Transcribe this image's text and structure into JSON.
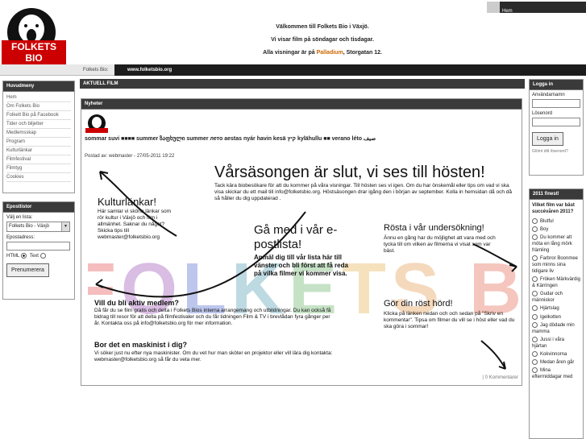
{
  "header": {
    "logo_text": "FOLKETS BIO",
    "line1": "Välkommen till Folkets Bio i Växjö.",
    "line2": "Vi visar film på söndagar och tisdagar.",
    "line3_pre": "Alla visningar är på",
    "line3_venue": "Palladium",
    "line3_post": ", Storgatan  12."
  },
  "topnav": {
    "home": "Hem"
  },
  "breadcrumb": {
    "label": "Folkets Bio:",
    "url": "www.folketsbio.org"
  },
  "menu": {
    "title": "Huvudmeny",
    "items": [
      "Hem",
      "Om Folkets Bio",
      "Folkett Bio på Facebook",
      "Tider och biljetter",
      "Medlemsskap",
      "Program",
      "Kulturlänkar",
      "Filmfestival",
      "Filmtyg",
      "Cookies"
    ]
  },
  "epost": {
    "title": "Epostlistor",
    "list_label": "Välj en lista:",
    "list_value": "Folkets Bio - Växjö",
    "address_label": "Epostadress:",
    "fmt_html": "HTML",
    "fmt_text": "Text",
    "submit": "Prenumerera"
  },
  "main": {
    "section_title": "AKTUELL FILM",
    "news_title": "Nyheter",
    "flags_line": "sommar suvi ■■■■ summer ზაფხული summer   лето aestas nyár havin kesä קיץ kylähullu ■■ verano léto صيف",
    "posted": "Postad av: webmaster - 27/05-2011 19:22",
    "comments": "| 0 Kommentarer"
  },
  "poster": {
    "bg_word": "FOLKETS BIO",
    "h1": "Vårsäsongen är slut, vi ses till hösten!",
    "p1": "Tack kära biobesökare för att du kommer på våra visningar. Till hösten ses vi igen. Om du har önskemål eller tips om vad vi ska visa skickar du ett mail till info@folketsbio.org. Höstsäsongen drar igång den i början av september. Kolla in hemsidan då och då så håller du dig uppdaterad .",
    "kultur_h": "Kulturlänkar!",
    "kultur_p": "Här samlar vi sköna länkar som rör kultur i Växjö och film i allmänhet. Saknar du något? Skicka tips till webmaster@folketsbio.org",
    "epost_h": "Gå med i vår e-postlista!",
    "epost_p": "Anmäl dig till vår lista här till vänster och bli först att få reda på vilka filmer vi kommer visa.",
    "rosta_h": "Rösta i vår undersökning!",
    "rosta_p": "Ännu en gång har du möjlighet att vara med och tycka till om vilken av filmerna vi visat som var bäst.",
    "medlem_h": "Vill du bli aktiv medlem?",
    "medlem_p": "Då får du se film gratis och delta i Folkets Bios interna arrangemang och utbildningar. Du kan också få bidrag till resor för att delta på filmfestivaler och du får tidningen Film & TV i brevlådan fyra gånger per år. Kontakta oss på info@folketsbio.org för mer information.",
    "rost_h": "Gör din röst hörd!",
    "rost_p": "Klicka på länken nedan och och sedan på \"Skriv en kommentar\". Tipsa om filmer du vill se i höst eller vad du ska göra i sommar!",
    "mask_h": "Bor det en maskinist i dig?",
    "mask_p": "Vi söker just nu efter nya maskinister. Om du vet hur man sköter en projektor eller vill lära dig kontakta: webmaster@folketsbio.org så får du veta mer."
  },
  "login": {
    "title": "Logga in",
    "user_label": "Användarnamn",
    "pass_label": "Lösenord",
    "submit": "Logga in",
    "forgot": "Glömt ditt lösenord?"
  },
  "poll": {
    "title": "2011 finest!",
    "question": "Vilket film var bäst succévåren 2011?",
    "options": [
      "Blutful",
      "Boy",
      "Du kommer att möta en lång mörk främling",
      "Farbror Boonmee som minns sina tidigare liv",
      "Fröken Märkvärdig & Kärringen",
      "Gudar och människor",
      "Hjärtslag",
      "Igelkotten",
      "Jag dödade min mamma",
      "Jussi i våra hjärtan",
      "Kokvinnorna",
      "Medan åren går",
      "Mina eftermiddagar med"
    ]
  },
  "colors": {
    "dark_bar": "#3a3a3a",
    "accent": "#cc6600",
    "logo_red": "#cc0000"
  }
}
